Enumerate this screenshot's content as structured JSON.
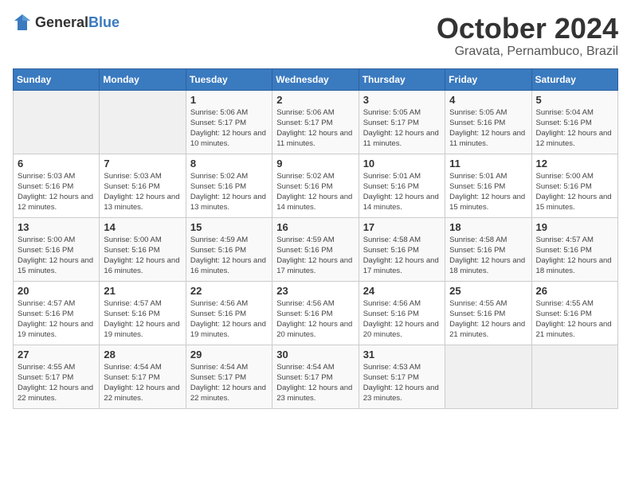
{
  "logo": {
    "text_general": "General",
    "text_blue": "Blue"
  },
  "header": {
    "month": "October 2024",
    "location": "Gravata, Pernambuco, Brazil"
  },
  "days_of_week": [
    "Sunday",
    "Monday",
    "Tuesday",
    "Wednesday",
    "Thursday",
    "Friday",
    "Saturday"
  ],
  "weeks": [
    [
      {
        "day": "",
        "info": ""
      },
      {
        "day": "",
        "info": ""
      },
      {
        "day": "1",
        "info": "Sunrise: 5:06 AM\nSunset: 5:17 PM\nDaylight: 12 hours\nand 10 minutes."
      },
      {
        "day": "2",
        "info": "Sunrise: 5:06 AM\nSunset: 5:17 PM\nDaylight: 12 hours\nand 11 minutes."
      },
      {
        "day": "3",
        "info": "Sunrise: 5:05 AM\nSunset: 5:17 PM\nDaylight: 12 hours\nand 11 minutes."
      },
      {
        "day": "4",
        "info": "Sunrise: 5:05 AM\nSunset: 5:16 PM\nDaylight: 12 hours\nand 11 minutes."
      },
      {
        "day": "5",
        "info": "Sunrise: 5:04 AM\nSunset: 5:16 PM\nDaylight: 12 hours\nand 12 minutes."
      }
    ],
    [
      {
        "day": "6",
        "info": "Sunrise: 5:03 AM\nSunset: 5:16 PM\nDaylight: 12 hours\nand 12 minutes."
      },
      {
        "day": "7",
        "info": "Sunrise: 5:03 AM\nSunset: 5:16 PM\nDaylight: 12 hours\nand 13 minutes."
      },
      {
        "day": "8",
        "info": "Sunrise: 5:02 AM\nSunset: 5:16 PM\nDaylight: 12 hours\nand 13 minutes."
      },
      {
        "day": "9",
        "info": "Sunrise: 5:02 AM\nSunset: 5:16 PM\nDaylight: 12 hours\nand 14 minutes."
      },
      {
        "day": "10",
        "info": "Sunrise: 5:01 AM\nSunset: 5:16 PM\nDaylight: 12 hours\nand 14 minutes."
      },
      {
        "day": "11",
        "info": "Sunrise: 5:01 AM\nSunset: 5:16 PM\nDaylight: 12 hours\nand 15 minutes."
      },
      {
        "day": "12",
        "info": "Sunrise: 5:00 AM\nSunset: 5:16 PM\nDaylight: 12 hours\nand 15 minutes."
      }
    ],
    [
      {
        "day": "13",
        "info": "Sunrise: 5:00 AM\nSunset: 5:16 PM\nDaylight: 12 hours\nand 15 minutes."
      },
      {
        "day": "14",
        "info": "Sunrise: 5:00 AM\nSunset: 5:16 PM\nDaylight: 12 hours\nand 16 minutes."
      },
      {
        "day": "15",
        "info": "Sunrise: 4:59 AM\nSunset: 5:16 PM\nDaylight: 12 hours\nand 16 minutes."
      },
      {
        "day": "16",
        "info": "Sunrise: 4:59 AM\nSunset: 5:16 PM\nDaylight: 12 hours\nand 17 minutes."
      },
      {
        "day": "17",
        "info": "Sunrise: 4:58 AM\nSunset: 5:16 PM\nDaylight: 12 hours\nand 17 minutes."
      },
      {
        "day": "18",
        "info": "Sunrise: 4:58 AM\nSunset: 5:16 PM\nDaylight: 12 hours\nand 18 minutes."
      },
      {
        "day": "19",
        "info": "Sunrise: 4:57 AM\nSunset: 5:16 PM\nDaylight: 12 hours\nand 18 minutes."
      }
    ],
    [
      {
        "day": "20",
        "info": "Sunrise: 4:57 AM\nSunset: 5:16 PM\nDaylight: 12 hours\nand 19 minutes."
      },
      {
        "day": "21",
        "info": "Sunrise: 4:57 AM\nSunset: 5:16 PM\nDaylight: 12 hours\nand 19 minutes."
      },
      {
        "day": "22",
        "info": "Sunrise: 4:56 AM\nSunset: 5:16 PM\nDaylight: 12 hours\nand 19 minutes."
      },
      {
        "day": "23",
        "info": "Sunrise: 4:56 AM\nSunset: 5:16 PM\nDaylight: 12 hours\nand 20 minutes."
      },
      {
        "day": "24",
        "info": "Sunrise: 4:56 AM\nSunset: 5:16 PM\nDaylight: 12 hours\nand 20 minutes."
      },
      {
        "day": "25",
        "info": "Sunrise: 4:55 AM\nSunset: 5:16 PM\nDaylight: 12 hours\nand 21 minutes."
      },
      {
        "day": "26",
        "info": "Sunrise: 4:55 AM\nSunset: 5:16 PM\nDaylight: 12 hours\nand 21 minutes."
      }
    ],
    [
      {
        "day": "27",
        "info": "Sunrise: 4:55 AM\nSunset: 5:17 PM\nDaylight: 12 hours\nand 22 minutes."
      },
      {
        "day": "28",
        "info": "Sunrise: 4:54 AM\nSunset: 5:17 PM\nDaylight: 12 hours\nand 22 minutes."
      },
      {
        "day": "29",
        "info": "Sunrise: 4:54 AM\nSunset: 5:17 PM\nDaylight: 12 hours\nand 22 minutes."
      },
      {
        "day": "30",
        "info": "Sunrise: 4:54 AM\nSunset: 5:17 PM\nDaylight: 12 hours\nand 23 minutes."
      },
      {
        "day": "31",
        "info": "Sunrise: 4:53 AM\nSunset: 5:17 PM\nDaylight: 12 hours\nand 23 minutes."
      },
      {
        "day": "",
        "info": ""
      },
      {
        "day": "",
        "info": ""
      }
    ]
  ]
}
